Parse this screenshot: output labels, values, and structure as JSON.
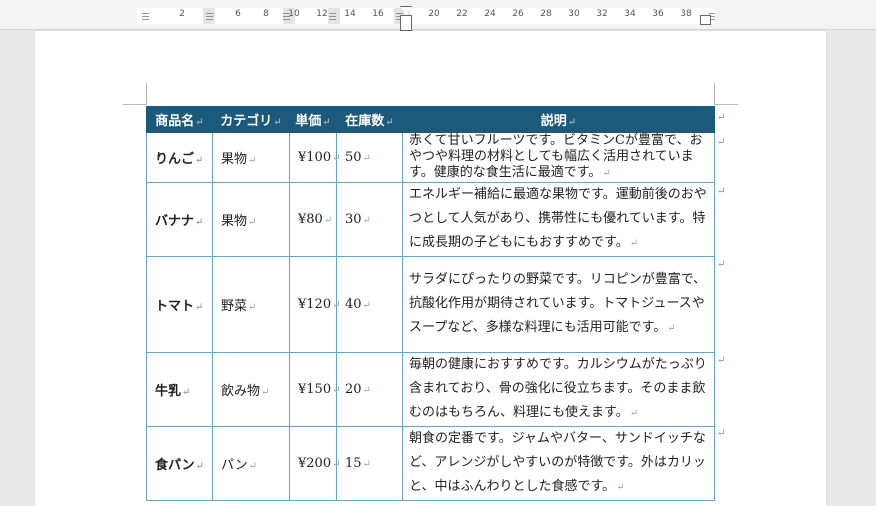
{
  "ruler": {
    "ticks": [
      "2",
      "6",
      "8",
      "10",
      "12",
      "14",
      "16",
      "20",
      "22",
      "24",
      "26",
      "28",
      "30",
      "32",
      "34",
      "36",
      "38"
    ]
  },
  "table": {
    "headers": [
      "商品名",
      "カテゴリ",
      "単価",
      "在庫数",
      "説明"
    ],
    "rows": [
      {
        "name": "りんご",
        "category": "果物",
        "price": "¥100",
        "stock": "50",
        "desc": "赤くて甘いフルーツです。ビタミンCが豊富で、おやつや料理の材料としても幅広く活用されています。健康的な食生活に最適です。"
      },
      {
        "name": "バナナ",
        "category": "果物",
        "price": "¥80",
        "stock": "30",
        "desc": "エネルギー補給に最適な果物です。運動前後のおやつとして人気があり、携帯性にも優れています。特に成長期の子どもにもおすすめです。"
      },
      {
        "name": "トマト",
        "category": "野菜",
        "price": "¥120",
        "stock": "40",
        "desc": "サラダにぴったりの野菜です。リコピンが豊富で、抗酸化作用が期待されています。トマトジュースやスープなど、多様な料理にも活用可能です。"
      },
      {
        "name": "牛乳",
        "category": "飲み物",
        "price": "¥150",
        "stock": "20",
        "desc": "毎朝の健康におすすめです。カルシウムがたっぷり含まれており、骨の強化に役立ちます。そのまま飲むのはもちろん、料理にも使えます。"
      },
      {
        "name": "食パン",
        "category": "パン",
        "price": "¥200",
        "stock": "15",
        "desc": "朝食の定番です。ジャムやバター、サンドイッチなど、アレンジがしやすいのが特徴です。外はカリッと、中はふんわりとした食感です。"
      }
    ]
  }
}
